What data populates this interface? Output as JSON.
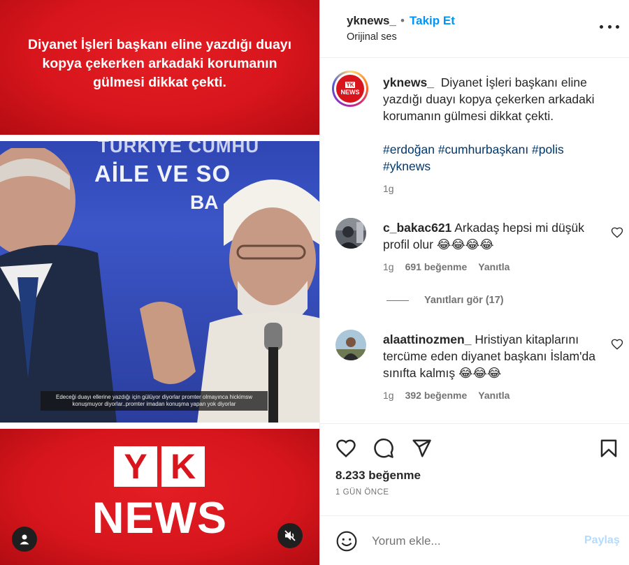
{
  "media": {
    "top_banner_text": "Diyanet İşleri başkanı eline yazdığı duayı kopya çekerken arkadaki korumanın gülmesi dikkat çekti.",
    "video_bg_line1": "TÜRKİYE CUMHU",
    "video_bg_line2": "AİLE VE SO",
    "video_bg_line3": "BA",
    "video_subtitle": "Edeceği duayı ellerine yazdığı için gülüyor diyorlar promter olmayınca hickimsw konuşmuyor diyorlar..promter imadan konuşma yapan yok diyorlar",
    "brand_letter1": "Y",
    "brand_letter2": "K",
    "brand_word": "NEWS",
    "user_button_icon": "user-icon",
    "mute_button_icon": "muted-speaker-icon",
    "brand_red": "#d8151c"
  },
  "header": {
    "username": "yknews_",
    "separator": "•",
    "follow_label": "Takip Et",
    "audio_label": "Orijinal ses",
    "more_icon": "more-options-icon",
    "follow_color": "#0095f6"
  },
  "caption": {
    "username": "yknews_",
    "text": "Diyanet İşleri başkanı eline yazdığı duayı kopya çekerken arkadaki korumanın gülmesi dikkat çekti.",
    "hashtags": "#erdoğan #cumhurbaşkanı #polis #yknews",
    "time": "1g",
    "avatar_letters": "YK",
    "avatar_word": "NEWS",
    "hashtag_color": "#00376b"
  },
  "comments": [
    {
      "username": "c_bakac621",
      "text": "Arkadaş hepsi mi düşük profil olur 😂😂😂😂",
      "time": "1g",
      "likes": "691 beğenme",
      "reply_label": "Yanıtla",
      "like_icon": "heart-outline-icon"
    },
    {
      "username": "alaattinozmen_",
      "text": "Hristiyan kitaplarını tercüme eden diyanet başkanı İslam'da sınıfta kalmış 😂😂😂",
      "time": "1g",
      "likes": "392 beğenme",
      "reply_label": "Yanıtla",
      "like_icon": "heart-outline-icon"
    }
  ],
  "view_replies_label": "Yanıtları gör (17)",
  "actions": {
    "like_icon": "heart-icon",
    "comment_icon": "comment-bubble-icon",
    "share_icon": "paper-plane-icon",
    "save_icon": "bookmark-icon",
    "likes_count": "8.233 beğenme",
    "post_time": "1 GÜN ÖNCE"
  },
  "composer": {
    "emoji_icon": "smiley-icon",
    "placeholder": "Yorum ekle...",
    "post_label": "Paylaş",
    "post_disabled_color": "#b3dbff"
  }
}
